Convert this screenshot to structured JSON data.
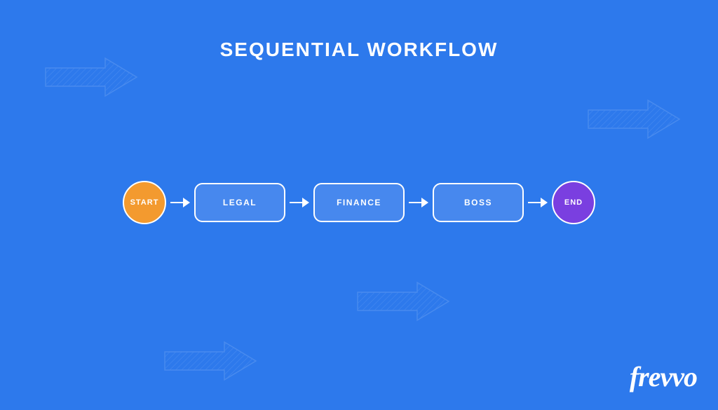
{
  "title": "SEQUENTIAL WORKFLOW",
  "workflow": {
    "start": {
      "label": "START",
      "color": "#f39a2f"
    },
    "steps": [
      {
        "label": "LEGAL"
      },
      {
        "label": "FINANCE"
      },
      {
        "label": "BOSS"
      }
    ],
    "end": {
      "label": "END",
      "color": "#7a3fe0"
    }
  },
  "brand": "frevvo",
  "colors": {
    "background": "#2d79ec",
    "box": "#4788ee",
    "stroke": "#ffffff"
  }
}
